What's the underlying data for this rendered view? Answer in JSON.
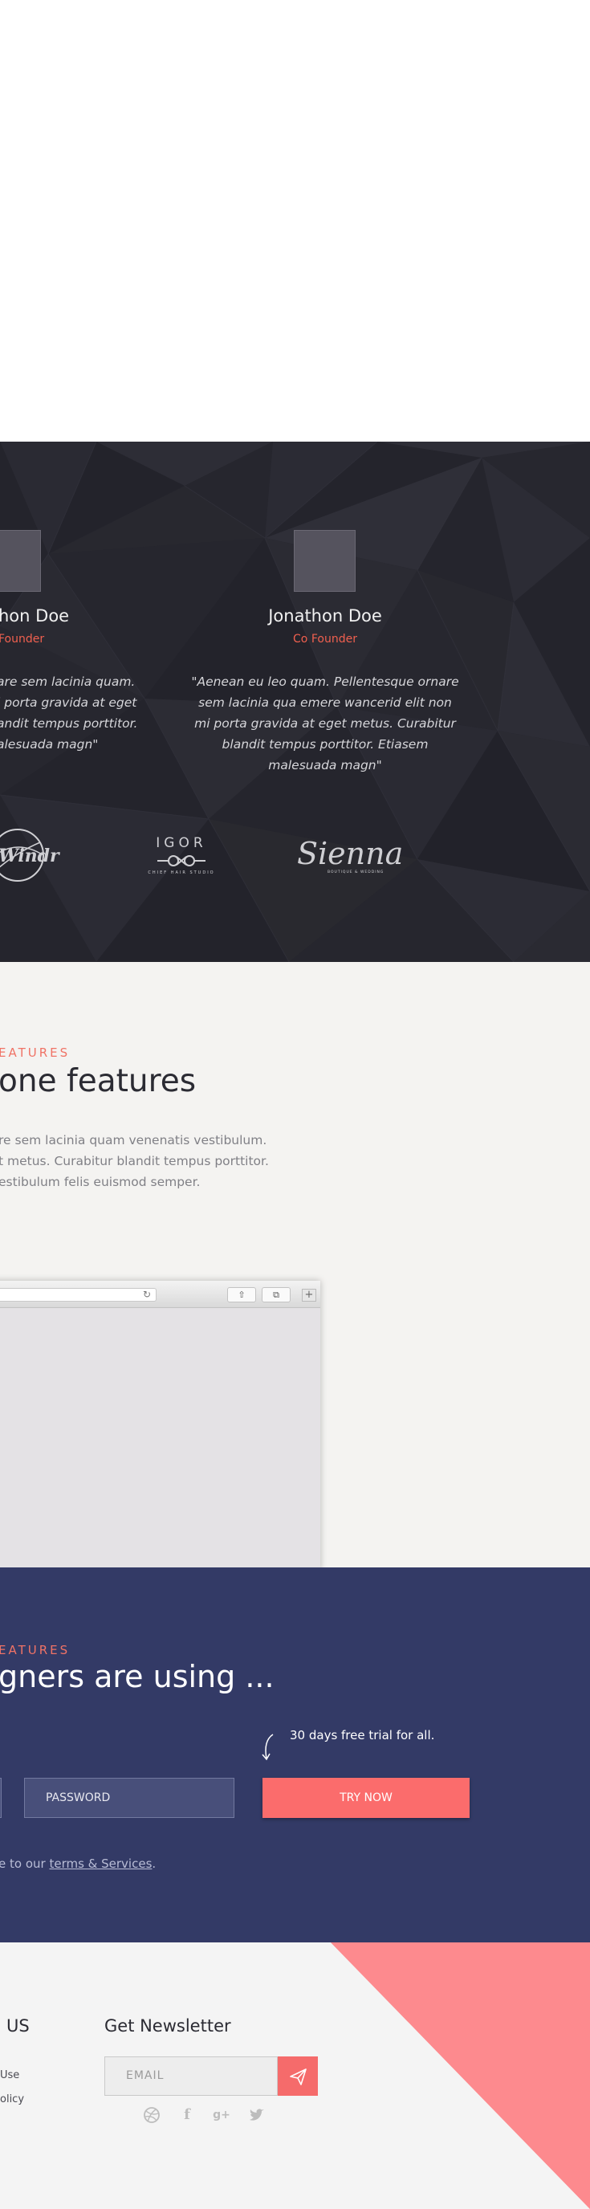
{
  "testimonials": {
    "items": [
      {
        "name": "hon Doe",
        "role": "Founder",
        "quote_lines": [
          "are sem lacinia quam.",
          "i porta gravida at eget",
          "andit tempus porttitor.",
          "alesuada magn\""
        ]
      },
      {
        "name": "Jonathon Doe",
        "role": "Co Founder",
        "quote_lines": [
          "\"Aenean eu leo quam. Pellentesque ornare",
          "sem lacinia qua emere wancerid elit non",
          "mi porta gravida at eget metus. Curabitur",
          "blandit tempus porttitor. Etiasem",
          "malesuada magn\""
        ]
      }
    ],
    "logos": {
      "first": "Windr",
      "igor_top": "IGOR",
      "igor_bottom": "CHIEF HAIR STUDIO",
      "sienna": "Sienna",
      "sienna_sub": "BOUTIQUE & WEDDING"
    }
  },
  "features": {
    "eyebrow": "EATURES",
    "title": "one features",
    "body_lines": [
      "re sem lacinia quam venenatis vestibulum.",
      "t metus. Curabitur blandit tempus porttitor.",
      "estibulum felis euismod semper."
    ],
    "browser": {
      "reload_icon": "↻",
      "share_icon": "⇧",
      "tabs_icon": "⧉",
      "new_tab_icon": "+"
    }
  },
  "signup": {
    "eyebrow": "EATURES",
    "title": "gners are using ...",
    "trial_note": "30 days free trial for all.",
    "password_placeholder": "PASSWORD",
    "try_button": "TRY NOW",
    "terms_prefix": "e to our ",
    "terms_link": "terms & Services",
    "terms_suffix": "."
  },
  "footer": {
    "contact_heading": "US",
    "links": [
      "Use",
      "olicy"
    ],
    "newsletter_heading": "Get Newsletter",
    "email_placeholder": "EMAIL",
    "social_icons": [
      "dribbble-icon",
      "facebook-icon",
      "google-plus-icon",
      "twitter-icon"
    ],
    "colors": {
      "accent": "#fb6c6c",
      "triangle": "#fd8a8e",
      "signup_bg": "#333a66",
      "dark_bg": "#25252d"
    }
  }
}
